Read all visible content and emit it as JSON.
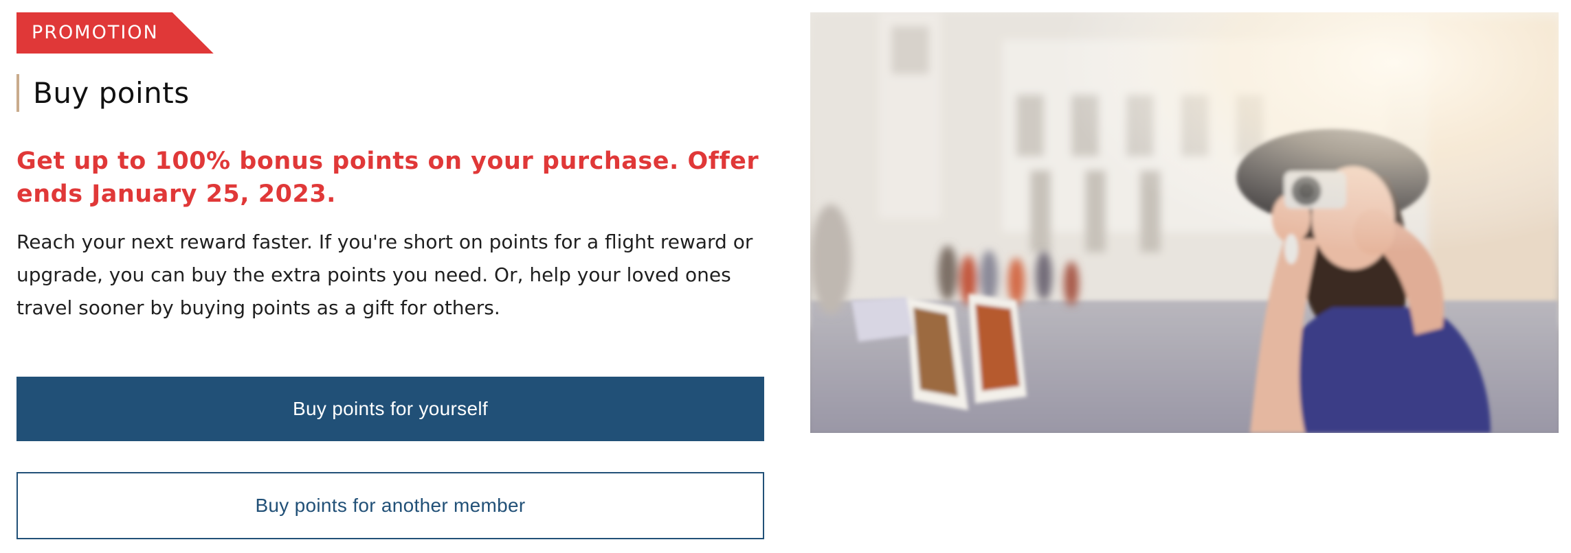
{
  "promotion": {
    "badge_label": "PROMOTION",
    "badge_color": "#e03838"
  },
  "header": {
    "title": "Buy points"
  },
  "offer": {
    "text": "Get up to 100% bonus points on your purchase. Offer ends January 25, 2023."
  },
  "description": {
    "text": "Reach your next reward faster. If you're short on points for a flight reward or upgrade, you can buy the extra points you need. Or, help your loved ones travel sooner by buying points as a gift for others."
  },
  "actions": {
    "primary_label": "Buy points for yourself",
    "secondary_label": "Buy points for another member",
    "primary_color": "#215077"
  },
  "hero_image": {
    "icon": "photo-woman-with-camera"
  }
}
